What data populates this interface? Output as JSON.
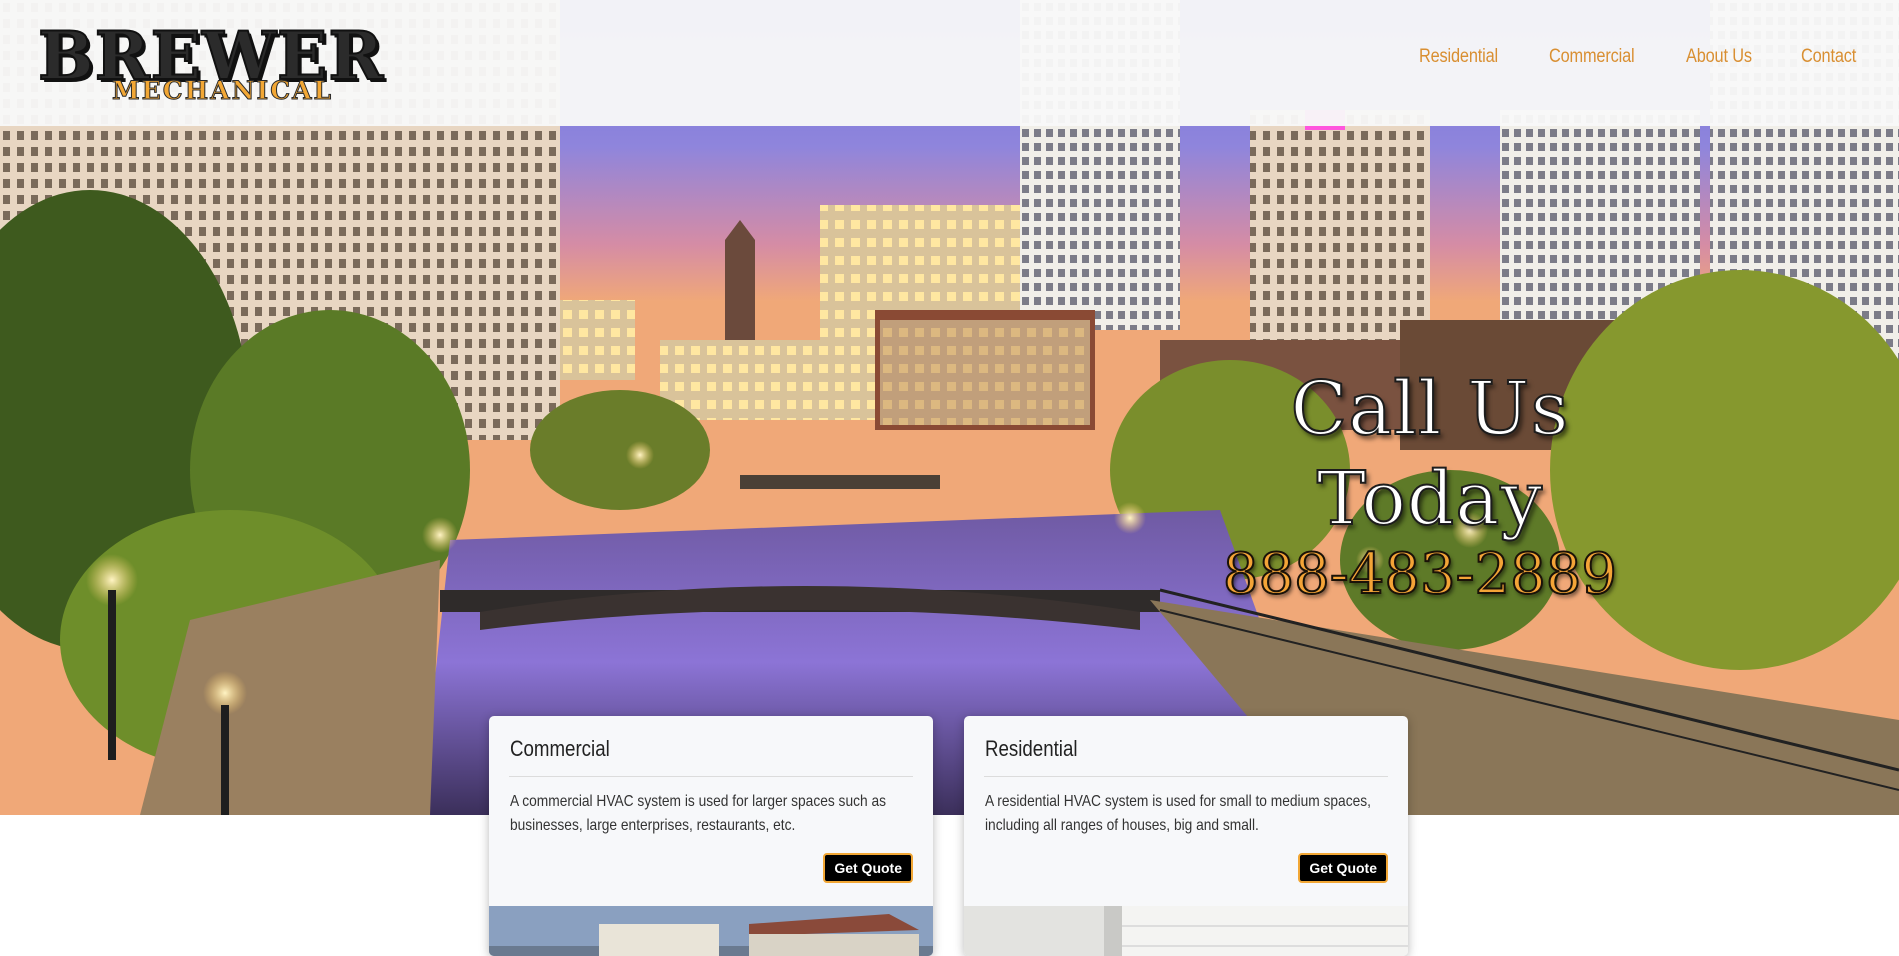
{
  "header": {
    "logo": {
      "line1": "BREWER",
      "line2": "MECHANICAL"
    },
    "nav": [
      "Residential",
      "Commercial",
      "About Us",
      "Contact"
    ]
  },
  "hero": {
    "callout_title": "Call Us Today",
    "callout_phone": "888-483-2889"
  },
  "cards": [
    {
      "title": "Commercial",
      "text": "A commercial HVAC system is used for larger spaces such as businesses, large enterprises, restaurants, etc.",
      "button": "Get Quote"
    },
    {
      "title": "Residential",
      "text": "A residential HVAC system is used for small to medium spaces, including all ranges of houses, big and small.",
      "button": "Get Quote"
    }
  ],
  "colors": {
    "accent": "#d98f32",
    "brand_orange": "#f2a735",
    "header_bg": "#f8f8f8",
    "button_bg": "#000000"
  }
}
